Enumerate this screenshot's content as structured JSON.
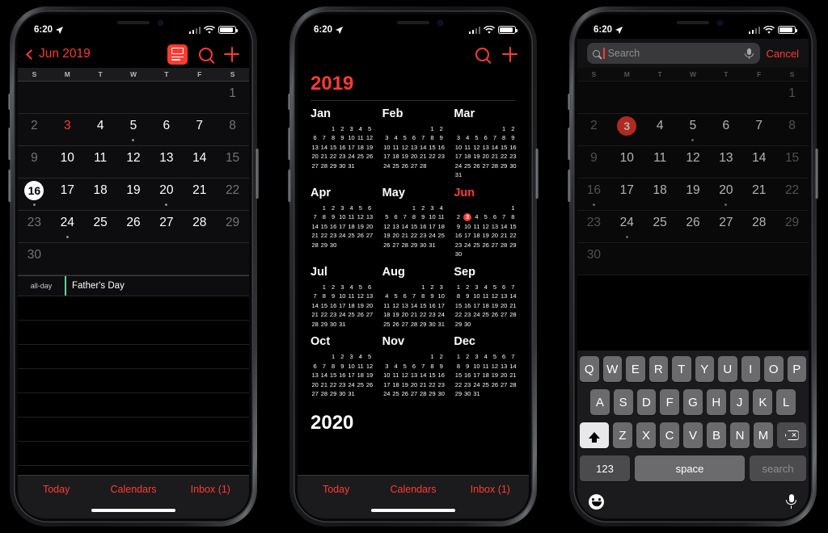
{
  "status_bar": {
    "time": "6:20",
    "location_icon": "location-arrow-icon",
    "cellular_icon": "cellular-bars-icon",
    "wifi_icon": "wifi-icon",
    "battery_icon": "battery-icon"
  },
  "colors": {
    "accent_red": "#ff3b30",
    "today_red": "#ff3b30",
    "event_green": "#63d297",
    "bg": "#000000",
    "bar_bg": "#1b1b1d"
  },
  "phone1": {
    "nav": {
      "back_label": "Jun 2019",
      "back_icon": "chevron-left-icon",
      "list_view_icon": "day-list-view-icon",
      "search_icon": "search-icon",
      "add_icon": "plus-icon"
    },
    "weekdays": [
      "S",
      "M",
      "T",
      "W",
      "T",
      "F",
      "S"
    ],
    "weeks": [
      [
        {
          "d": "",
          "dim": false
        },
        {
          "d": "",
          "dim": false
        },
        {
          "d": "",
          "dim": false
        },
        {
          "d": "",
          "dim": false
        },
        {
          "d": "",
          "dim": false
        },
        {
          "d": "",
          "dim": false
        },
        {
          "d": "1",
          "dim": true
        }
      ],
      [
        {
          "d": "2",
          "dim": true
        },
        {
          "d": "3",
          "red": true
        },
        {
          "d": "4"
        },
        {
          "d": "5",
          "dot": true
        },
        {
          "d": "6"
        },
        {
          "d": "7"
        },
        {
          "d": "8",
          "dim": true
        }
      ],
      [
        {
          "d": "9",
          "dim": true
        },
        {
          "d": "10"
        },
        {
          "d": "11"
        },
        {
          "d": "12"
        },
        {
          "d": "13"
        },
        {
          "d": "14"
        },
        {
          "d": "15",
          "dim": true
        }
      ],
      [
        {
          "d": "16",
          "selected": true,
          "dot": true
        },
        {
          "d": "17"
        },
        {
          "d": "18"
        },
        {
          "d": "19"
        },
        {
          "d": "20",
          "dot": true
        },
        {
          "d": "21"
        },
        {
          "d": "22",
          "dim": true
        }
      ],
      [
        {
          "d": "23",
          "dim": true
        },
        {
          "d": "24",
          "dot": true
        },
        {
          "d": "25"
        },
        {
          "d": "26"
        },
        {
          "d": "27"
        },
        {
          "d": "28"
        },
        {
          "d": "29",
          "dim": true
        }
      ],
      [
        {
          "d": "30",
          "dim": true
        },
        {
          "d": ""
        },
        {
          "d": ""
        },
        {
          "d": ""
        },
        {
          "d": ""
        },
        {
          "d": ""
        },
        {
          "d": ""
        }
      ]
    ],
    "all_day_label": "all-day",
    "event_title": "Father's Day",
    "toolbar": {
      "today": "Today",
      "calendars": "Calendars",
      "inbox": "Inbox (1)"
    }
  },
  "phone2": {
    "nav": {
      "search_icon": "search-icon",
      "add_icon": "plus-icon"
    },
    "year_current": "2019",
    "year_next": "2020",
    "months": [
      {
        "name": "Jan",
        "red": false,
        "lead": 2,
        "days": 31,
        "today": null
      },
      {
        "name": "Feb",
        "red": false,
        "lead": 5,
        "days": 28,
        "today": null
      },
      {
        "name": "Mar",
        "red": false,
        "lead": 5,
        "days": 31,
        "today": null
      },
      {
        "name": "Apr",
        "red": false,
        "lead": 1,
        "days": 30,
        "today": null
      },
      {
        "name": "May",
        "red": false,
        "lead": 3,
        "days": 31,
        "today": null
      },
      {
        "name": "Jun",
        "red": true,
        "lead": 6,
        "days": 30,
        "today": 3
      },
      {
        "name": "Jul",
        "red": false,
        "lead": 1,
        "days": 31,
        "today": null
      },
      {
        "name": "Aug",
        "red": false,
        "lead": 4,
        "days": 31,
        "today": null
      },
      {
        "name": "Sep",
        "red": false,
        "lead": 0,
        "days": 30,
        "today": null
      },
      {
        "name": "Oct",
        "red": false,
        "lead": 2,
        "days": 31,
        "today": null
      },
      {
        "name": "Nov",
        "red": false,
        "lead": 5,
        "days": 30,
        "today": null
      },
      {
        "name": "Dec",
        "red": false,
        "lead": 0,
        "days": 31,
        "today": null
      }
    ],
    "toolbar": {
      "today": "Today",
      "calendars": "Calendars",
      "inbox": "Inbox (1)"
    }
  },
  "phone3": {
    "search": {
      "placeholder": "Search",
      "value": "",
      "search_icon": "search-icon",
      "mic_icon": "microphone-icon",
      "cancel_label": "Cancel"
    },
    "weekdays": [
      "S",
      "M",
      "T",
      "W",
      "T",
      "F",
      "S"
    ],
    "weeks": [
      [
        {
          "d": ""
        },
        {
          "d": ""
        },
        {
          "d": ""
        },
        {
          "d": ""
        },
        {
          "d": ""
        },
        {
          "d": ""
        },
        {
          "d": "1",
          "dim": true
        }
      ],
      [
        {
          "d": "2",
          "dim": true
        },
        {
          "d": "3",
          "today": true
        },
        {
          "d": "4"
        },
        {
          "d": "5",
          "dot": true
        },
        {
          "d": "6"
        },
        {
          "d": "7"
        },
        {
          "d": "8",
          "dim": true
        }
      ],
      [
        {
          "d": "9",
          "dim": true
        },
        {
          "d": "10"
        },
        {
          "d": "11"
        },
        {
          "d": "12"
        },
        {
          "d": "13"
        },
        {
          "d": "14"
        },
        {
          "d": "15",
          "dim": true
        }
      ],
      [
        {
          "d": "16",
          "dim": true,
          "dot": true
        },
        {
          "d": "17"
        },
        {
          "d": "18"
        },
        {
          "d": "19"
        },
        {
          "d": "20",
          "dot": true
        },
        {
          "d": "21"
        },
        {
          "d": "22",
          "dim": true
        }
      ],
      [
        {
          "d": "23",
          "dim": true
        },
        {
          "d": "24",
          "dot": true
        },
        {
          "d": "25"
        },
        {
          "d": "26"
        },
        {
          "d": "27"
        },
        {
          "d": "28"
        },
        {
          "d": "29",
          "dim": true
        }
      ],
      [
        {
          "d": "30",
          "dim": true
        },
        {
          "d": ""
        },
        {
          "d": ""
        },
        {
          "d": ""
        },
        {
          "d": ""
        },
        {
          "d": ""
        },
        {
          "d": ""
        }
      ]
    ],
    "keyboard": {
      "row1": [
        "Q",
        "W",
        "E",
        "R",
        "T",
        "Y",
        "U",
        "I",
        "O",
        "P"
      ],
      "row2": [
        "A",
        "S",
        "D",
        "F",
        "G",
        "H",
        "J",
        "K",
        "L"
      ],
      "row3": [
        "Z",
        "X",
        "C",
        "V",
        "B",
        "N",
        "M"
      ],
      "shift_icon": "shift-arrow-icon",
      "delete_icon": "delete-backspace-icon",
      "numbers_label": "123",
      "space_label": "space",
      "search_label": "search",
      "emoji_icon": "emoji-smiley-icon",
      "dictation_icon": "microphone-icon"
    }
  }
}
